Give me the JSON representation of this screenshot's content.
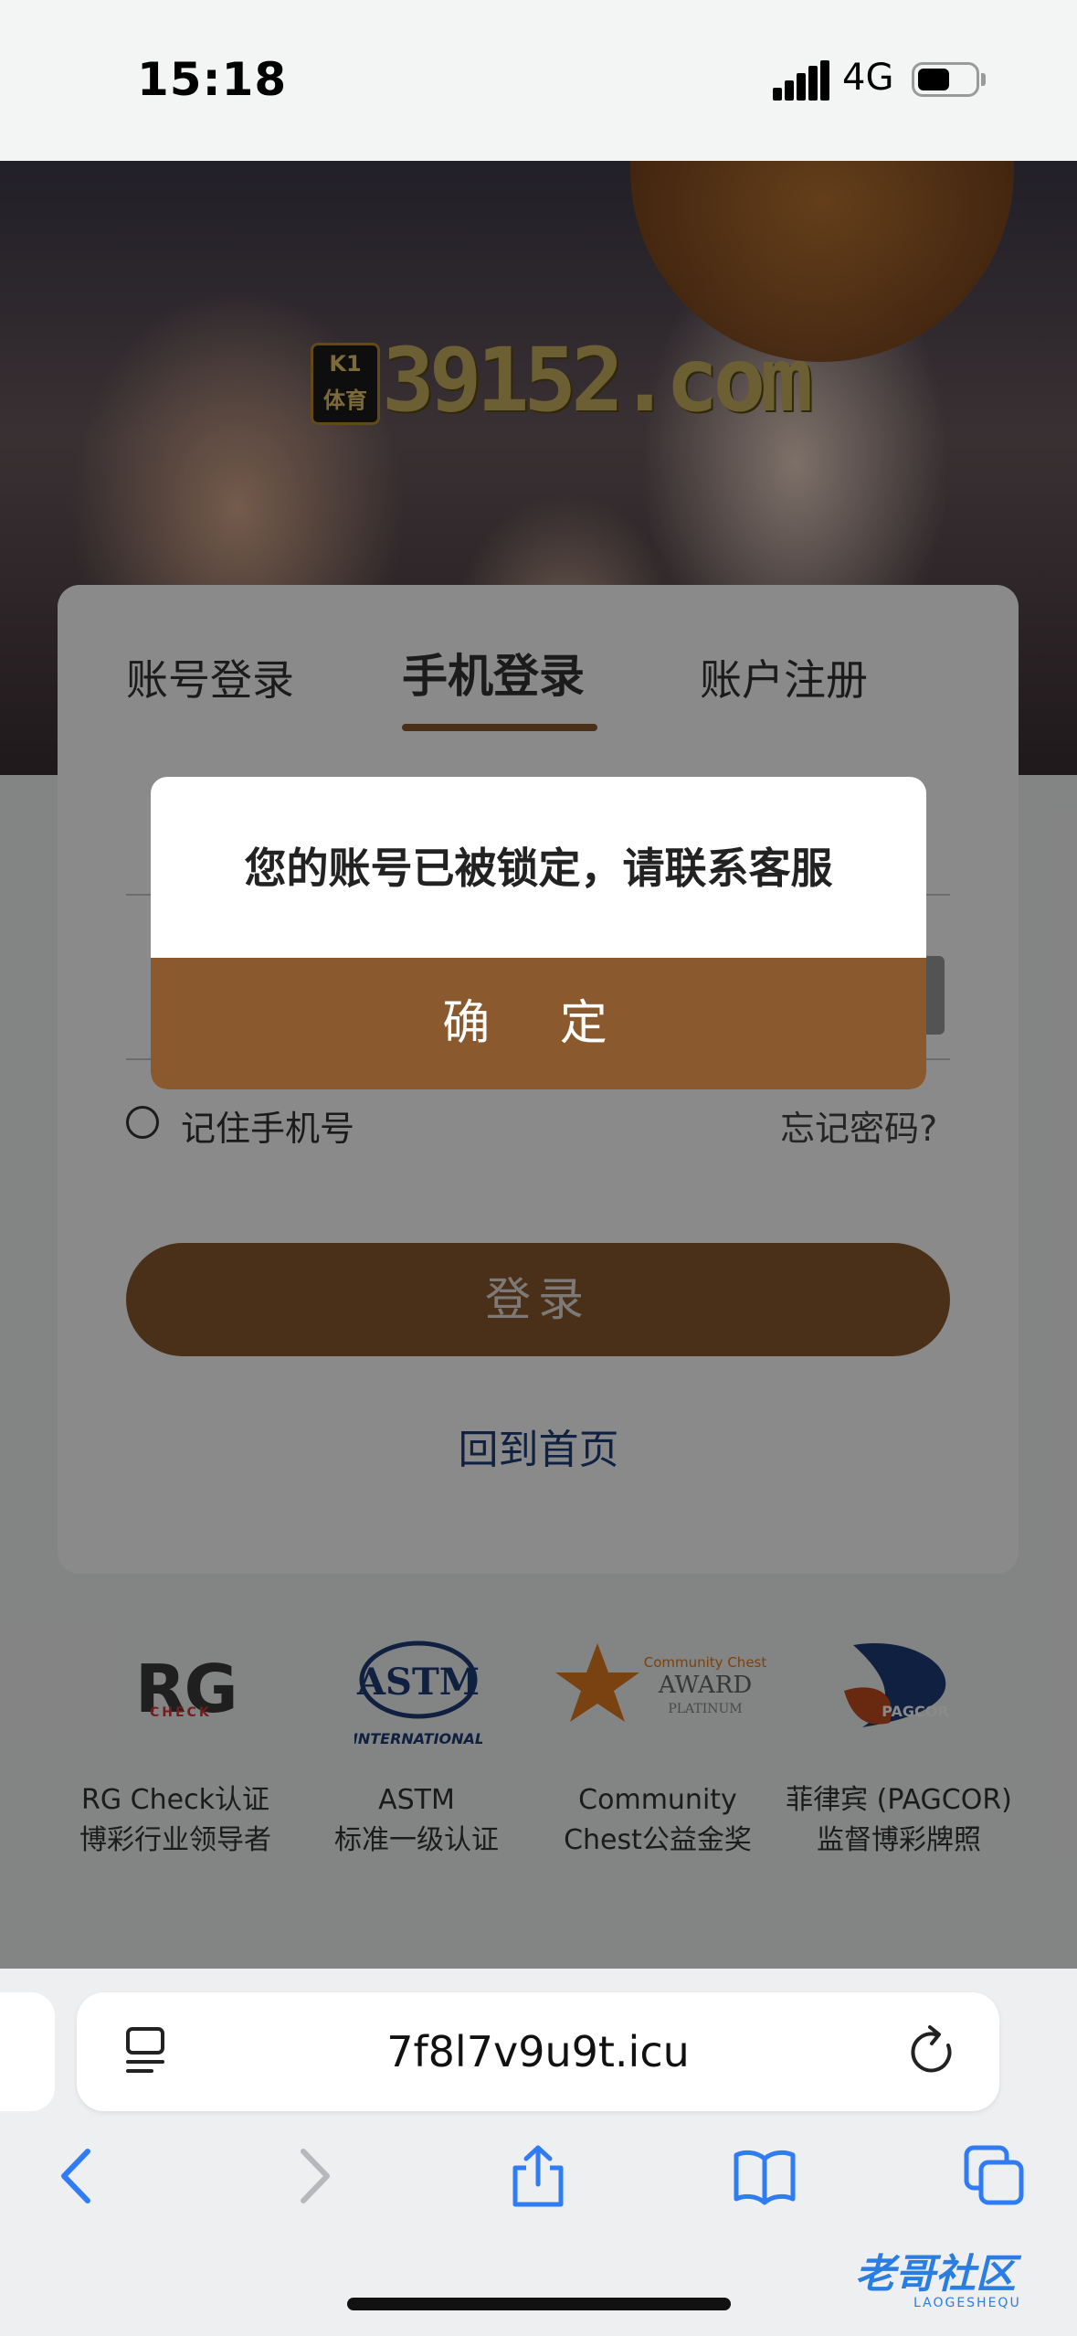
{
  "status_bar": {
    "time": "15:18",
    "network": "4G",
    "battery_level": 0.55
  },
  "hero": {
    "badge_top": "K1",
    "badge_bottom": "体育",
    "site": "39152.com"
  },
  "login": {
    "tabs": [
      "账号登录",
      "手机登录",
      "账户注册"
    ],
    "active_tab": 1,
    "remember_label": "记住手机号",
    "forgot_label": "忘记密码?",
    "login_button": "登录",
    "home_link": "回到首页"
  },
  "badges": [
    {
      "logo_text": "RG",
      "logo_sub": "CHECK",
      "line1": "RG Check认证",
      "line2": "博彩行业领导者"
    },
    {
      "logo_text": "ASTM",
      "logo_sub": "INTERNATIONAL",
      "line1": "ASTM",
      "line2": "标准一级认证"
    },
    {
      "logo_text": "Community Chest",
      "logo_sub": "AWARD",
      "logo_sub2": "PLATINUM",
      "line1": "Community",
      "line2": "Chest公益金奖"
    },
    {
      "logo_text": "PAGCOR",
      "line1": "菲律宾 (PAGCOR)",
      "line2": "监督博彩牌照"
    }
  ],
  "dialog": {
    "message": "您的账号已被锁定，请联系客服",
    "confirm": "确 定"
  },
  "browser": {
    "url": "7f8l7v9u9t.icu"
  },
  "watermark": {
    "text": "老哥社区",
    "sub": "LAOGESHEQU"
  },
  "colors": {
    "brand": "#8a5a2e",
    "link": "#1f3f78",
    "ios_blue": "#2f7cf6"
  }
}
